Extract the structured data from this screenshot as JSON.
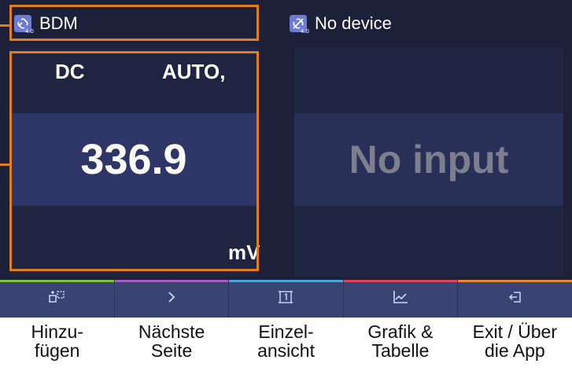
{
  "devices": [
    {
      "name": "BDM",
      "version": "4.0",
      "mode": "DC",
      "range": "AUTO,",
      "value": "336.9",
      "unit": "mV"
    },
    {
      "name": "No device",
      "version": "4.0",
      "value": "No input"
    }
  ],
  "softkeys": [
    {
      "icon": "add-device-icon",
      "accent": "#7cc13a",
      "label_line1": "Hinzu-",
      "label_line2": "fügen"
    },
    {
      "icon": "chevron-right-icon",
      "accent": "#a55cc4",
      "label_line1": "Nächste",
      "label_line2": "Seite"
    },
    {
      "icon": "single-view-icon",
      "accent": "#4ba3df",
      "label_line1": "Einzel-",
      "label_line2": "ansicht"
    },
    {
      "icon": "chart-icon",
      "accent": "#e0405a",
      "label_line1": "Grafik &",
      "label_line2": "Tabelle"
    },
    {
      "icon": "exit-icon",
      "accent": "#e88a2a",
      "label_line1": "Exit / Über",
      "label_line2": "die App"
    }
  ],
  "colors": {
    "screen_bg": "#1c2038",
    "value_band": "#2e3567",
    "softkey_bg": "#3a4473",
    "highlight": "#e07d22"
  }
}
